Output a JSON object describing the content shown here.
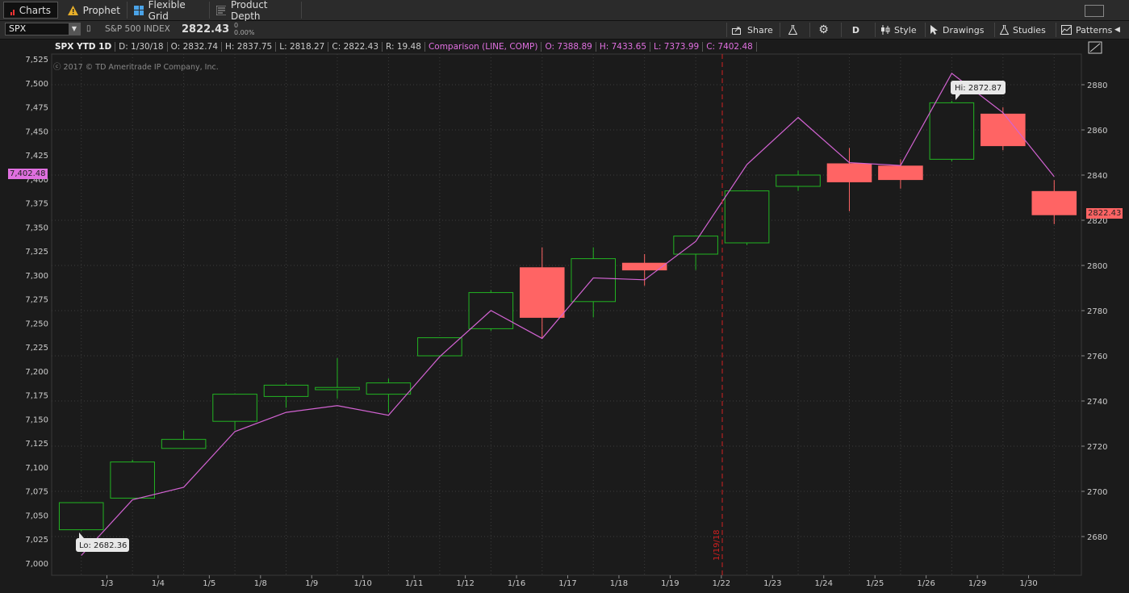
{
  "tabs": [
    {
      "label": "Charts",
      "icon": "bar-chart-icon",
      "active": true
    },
    {
      "label": "Prophet",
      "icon": "warning-triangle-icon",
      "active": false
    },
    {
      "label": "Flexible Grid",
      "icon": "grid-icon",
      "active": false
    },
    {
      "label": "Product Depth",
      "icon": "depth-icon",
      "active": false
    }
  ],
  "toolbar": {
    "symbol": "SPX",
    "description": "S&P 500 INDEX",
    "last_price": "2822.43",
    "change": "0",
    "change_pct": "0.00%",
    "share": "Share",
    "aggregation": "D",
    "style": "Style",
    "drawings": "Drawings",
    "studies": "Studies",
    "patterns": "Patterns"
  },
  "info": {
    "title": "SPX YTD 1D",
    "date": "D: 1/30/18",
    "open": "O: 2832.74",
    "high": "H: 2837.75",
    "low": "L: 2818.27",
    "close": "C: 2822.43",
    "range": "R: 19.48",
    "comparison": "Comparison (LINE, COMP)",
    "cmp_open": "O: 7388.89",
    "cmp_high": "H: 7433.65",
    "cmp_low": "L: 7373.99",
    "cmp_close": "C: 7402.48",
    "copyright": "2017 © TD Ameritrade IP Company, Inc."
  },
  "labels": {
    "left_price": "7,402.48",
    "right_price": "2822.43",
    "hi": "Hi: 2872.87",
    "lo": "Lo: 2682.36",
    "marker": "1/19/18"
  },
  "colors": {
    "up": "#22b422",
    "down": "#ff6464",
    "comparison": "#d363d3",
    "marker": "#d02020"
  },
  "chart_data": {
    "type": "candlestick",
    "categories": [
      "1/3",
      "1/4",
      "1/5",
      "1/8",
      "1/9",
      "1/10",
      "1/11",
      "1/12",
      "1/16",
      "1/17",
      "1/18",
      "1/19",
      "1/22",
      "1/23",
      "1/24",
      "1/25",
      "1/26",
      "1/29",
      "1/30"
    ],
    "candles": [
      {
        "o": 2683,
        "h": 2695,
        "l": 2682.36,
        "c": 2695
      },
      {
        "o": 2697,
        "h": 2714,
        "l": 2697,
        "c": 2713
      },
      {
        "o": 2719,
        "h": 2727,
        "l": 2719,
        "c": 2723
      },
      {
        "o": 2731,
        "h": 2743,
        "l": 2727,
        "c": 2743
      },
      {
        "o": 2742,
        "h": 2748,
        "l": 2737,
        "c": 2747
      },
      {
        "o": 2745,
        "h": 2759,
        "l": 2741,
        "c": 2746
      },
      {
        "o": 2743,
        "h": 2750,
        "l": 2735,
        "c": 2748
      },
      {
        "o": 2760,
        "h": 2768,
        "l": 2760,
        "c": 2768
      },
      {
        "o": 2772,
        "h": 2789,
        "l": 2771,
        "c": 2788
      },
      {
        "o": 2799,
        "h": 2808,
        "l": 2768,
        "c": 2777
      },
      {
        "o": 2784,
        "h": 2808,
        "l": 2777,
        "c": 2803
      },
      {
        "o": 2801,
        "h": 2805,
        "l": 2791,
        "c": 2798
      },
      {
        "o": 2805,
        "h": 2812,
        "l": 2798,
        "c": 2813
      },
      {
        "o": 2810,
        "h": 2833,
        "l": 2809,
        "c": 2833
      },
      {
        "o": 2835,
        "h": 2842,
        "l": 2833,
        "c": 2840
      },
      {
        "o": 2845,
        "h": 2852,
        "l": 2824,
        "c": 2837
      },
      {
        "o": 2844,
        "h": 2847,
        "l": 2834,
        "c": 2838
      },
      {
        "o": 2847,
        "h": 2872.87,
        "l": 2846,
        "c": 2872
      },
      {
        "o": 2867,
        "h": 2870,
        "l": 2851,
        "c": 2853
      },
      {
        "o": 2832.74,
        "h": 2837.75,
        "l": 2818.27,
        "c": 2822.43
      }
    ],
    "comparison": {
      "name": "Comparison (LINE, COMP)",
      "values": [
        7008,
        7066,
        7079,
        7137,
        7157,
        7164,
        7154,
        7215,
        7263,
        7234,
        7297,
        7295,
        7335,
        7415,
        7464,
        7417,
        7414,
        7510,
        7469,
        7402.48
      ]
    },
    "left_axis": {
      "min": 7000,
      "max": 7525,
      "ticks": [
        "7,000",
        "7,025",
        "7,050",
        "7,075",
        "7,100",
        "7,125",
        "7,150",
        "7,175",
        "7,200",
        "7,225",
        "7,250",
        "7,275",
        "7,300",
        "7,325",
        "7,350",
        "7,375",
        "7,400",
        "7,425",
        "7,450",
        "7,475",
        "7,500",
        "7,525"
      ]
    },
    "right_axis": {
      "ticks": [
        "2680",
        "2700",
        "2720",
        "2740",
        "2760",
        "2780",
        "2800",
        "2820",
        "2840",
        "2860",
        "2880"
      ]
    },
    "grid": true
  }
}
